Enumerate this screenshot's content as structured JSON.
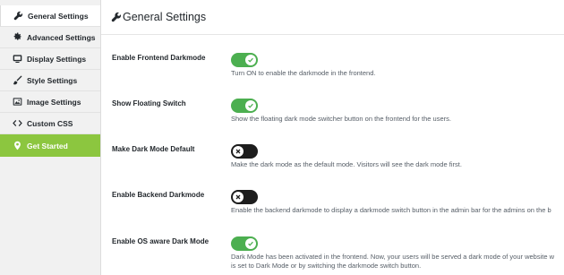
{
  "sidebar": {
    "items": [
      {
        "label": "General Settings",
        "icon": "wrench-icon"
      },
      {
        "label": "Advanced Settings",
        "icon": "gear-icon"
      },
      {
        "label": "Display Settings",
        "icon": "monitor-icon"
      },
      {
        "label": "Style Settings",
        "icon": "brush-icon"
      },
      {
        "label": "Image Settings",
        "icon": "image-icon"
      },
      {
        "label": "Custom CSS",
        "icon": "code-icon"
      },
      {
        "label": "Get Started",
        "icon": "location-pin-icon"
      }
    ]
  },
  "header": {
    "title": "General Settings",
    "icon": "wrench-icon"
  },
  "settings": [
    {
      "label": "Enable Frontend Darkmode",
      "state": "on",
      "description": "Turn ON to enable the darkmode in the frontend."
    },
    {
      "label": "Show Floating Switch",
      "state": "on",
      "description": "Show the floating dark mode switcher button on the frontend for the users."
    },
    {
      "label": "Make Dark Mode Default",
      "state": "off",
      "description": "Make the dark mode as the default mode. Visitors will see the dark mode first."
    },
    {
      "label": "Enable Backend Darkmode",
      "state": "off",
      "description": "Enable the backend darkmode to display a darkmode switch button in the admin bar for the admins on the b"
    },
    {
      "label": "Enable OS aware Dark Mode",
      "state": "on",
      "description": "Dark Mode has been activated in the frontend. Now, your users will be served a dark mode of your website w",
      "description_line2": "is set to Dark Mode or by switching the darkmode switch button."
    }
  ],
  "colors": {
    "accent_green": "#8cc63f",
    "toggle_on": "#4caf50",
    "toggle_off": "#1d1d1d"
  }
}
